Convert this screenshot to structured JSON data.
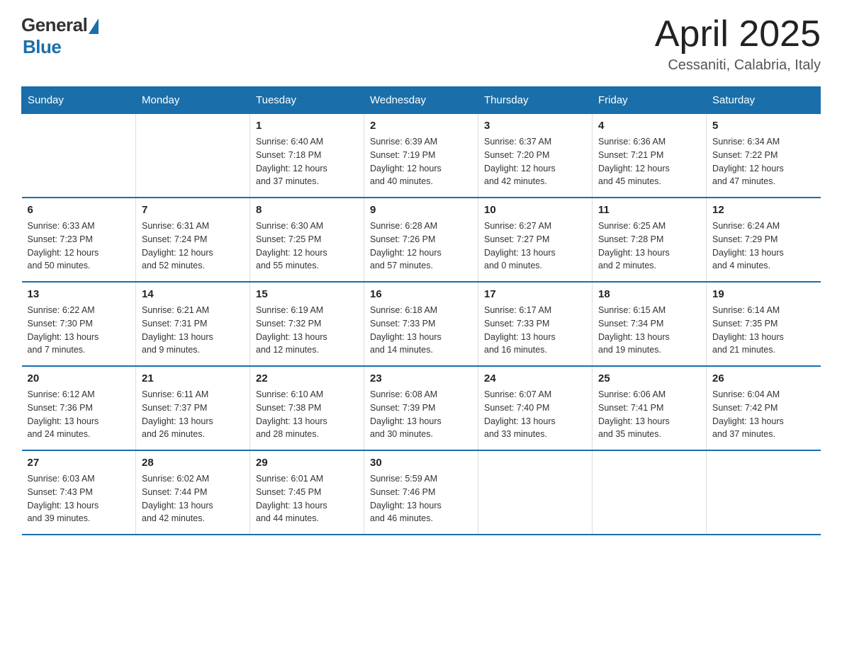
{
  "logo": {
    "general": "General",
    "blue": "Blue"
  },
  "title": "April 2025",
  "location": "Cessaniti, Calabria, Italy",
  "days_of_week": [
    "Sunday",
    "Monday",
    "Tuesday",
    "Wednesday",
    "Thursday",
    "Friday",
    "Saturday"
  ],
  "weeks": [
    [
      {
        "day": "",
        "info": ""
      },
      {
        "day": "",
        "info": ""
      },
      {
        "day": "1",
        "info": "Sunrise: 6:40 AM\nSunset: 7:18 PM\nDaylight: 12 hours\nand 37 minutes."
      },
      {
        "day": "2",
        "info": "Sunrise: 6:39 AM\nSunset: 7:19 PM\nDaylight: 12 hours\nand 40 minutes."
      },
      {
        "day": "3",
        "info": "Sunrise: 6:37 AM\nSunset: 7:20 PM\nDaylight: 12 hours\nand 42 minutes."
      },
      {
        "day": "4",
        "info": "Sunrise: 6:36 AM\nSunset: 7:21 PM\nDaylight: 12 hours\nand 45 minutes."
      },
      {
        "day": "5",
        "info": "Sunrise: 6:34 AM\nSunset: 7:22 PM\nDaylight: 12 hours\nand 47 minutes."
      }
    ],
    [
      {
        "day": "6",
        "info": "Sunrise: 6:33 AM\nSunset: 7:23 PM\nDaylight: 12 hours\nand 50 minutes."
      },
      {
        "day": "7",
        "info": "Sunrise: 6:31 AM\nSunset: 7:24 PM\nDaylight: 12 hours\nand 52 minutes."
      },
      {
        "day": "8",
        "info": "Sunrise: 6:30 AM\nSunset: 7:25 PM\nDaylight: 12 hours\nand 55 minutes."
      },
      {
        "day": "9",
        "info": "Sunrise: 6:28 AM\nSunset: 7:26 PM\nDaylight: 12 hours\nand 57 minutes."
      },
      {
        "day": "10",
        "info": "Sunrise: 6:27 AM\nSunset: 7:27 PM\nDaylight: 13 hours\nand 0 minutes."
      },
      {
        "day": "11",
        "info": "Sunrise: 6:25 AM\nSunset: 7:28 PM\nDaylight: 13 hours\nand 2 minutes."
      },
      {
        "day": "12",
        "info": "Sunrise: 6:24 AM\nSunset: 7:29 PM\nDaylight: 13 hours\nand 4 minutes."
      }
    ],
    [
      {
        "day": "13",
        "info": "Sunrise: 6:22 AM\nSunset: 7:30 PM\nDaylight: 13 hours\nand 7 minutes."
      },
      {
        "day": "14",
        "info": "Sunrise: 6:21 AM\nSunset: 7:31 PM\nDaylight: 13 hours\nand 9 minutes."
      },
      {
        "day": "15",
        "info": "Sunrise: 6:19 AM\nSunset: 7:32 PM\nDaylight: 13 hours\nand 12 minutes."
      },
      {
        "day": "16",
        "info": "Sunrise: 6:18 AM\nSunset: 7:33 PM\nDaylight: 13 hours\nand 14 minutes."
      },
      {
        "day": "17",
        "info": "Sunrise: 6:17 AM\nSunset: 7:33 PM\nDaylight: 13 hours\nand 16 minutes."
      },
      {
        "day": "18",
        "info": "Sunrise: 6:15 AM\nSunset: 7:34 PM\nDaylight: 13 hours\nand 19 minutes."
      },
      {
        "day": "19",
        "info": "Sunrise: 6:14 AM\nSunset: 7:35 PM\nDaylight: 13 hours\nand 21 minutes."
      }
    ],
    [
      {
        "day": "20",
        "info": "Sunrise: 6:12 AM\nSunset: 7:36 PM\nDaylight: 13 hours\nand 24 minutes."
      },
      {
        "day": "21",
        "info": "Sunrise: 6:11 AM\nSunset: 7:37 PM\nDaylight: 13 hours\nand 26 minutes."
      },
      {
        "day": "22",
        "info": "Sunrise: 6:10 AM\nSunset: 7:38 PM\nDaylight: 13 hours\nand 28 minutes."
      },
      {
        "day": "23",
        "info": "Sunrise: 6:08 AM\nSunset: 7:39 PM\nDaylight: 13 hours\nand 30 minutes."
      },
      {
        "day": "24",
        "info": "Sunrise: 6:07 AM\nSunset: 7:40 PM\nDaylight: 13 hours\nand 33 minutes."
      },
      {
        "day": "25",
        "info": "Sunrise: 6:06 AM\nSunset: 7:41 PM\nDaylight: 13 hours\nand 35 minutes."
      },
      {
        "day": "26",
        "info": "Sunrise: 6:04 AM\nSunset: 7:42 PM\nDaylight: 13 hours\nand 37 minutes."
      }
    ],
    [
      {
        "day": "27",
        "info": "Sunrise: 6:03 AM\nSunset: 7:43 PM\nDaylight: 13 hours\nand 39 minutes."
      },
      {
        "day": "28",
        "info": "Sunrise: 6:02 AM\nSunset: 7:44 PM\nDaylight: 13 hours\nand 42 minutes."
      },
      {
        "day": "29",
        "info": "Sunrise: 6:01 AM\nSunset: 7:45 PM\nDaylight: 13 hours\nand 44 minutes."
      },
      {
        "day": "30",
        "info": "Sunrise: 5:59 AM\nSunset: 7:46 PM\nDaylight: 13 hours\nand 46 minutes."
      },
      {
        "day": "",
        "info": ""
      },
      {
        "day": "",
        "info": ""
      },
      {
        "day": "",
        "info": ""
      }
    ]
  ]
}
